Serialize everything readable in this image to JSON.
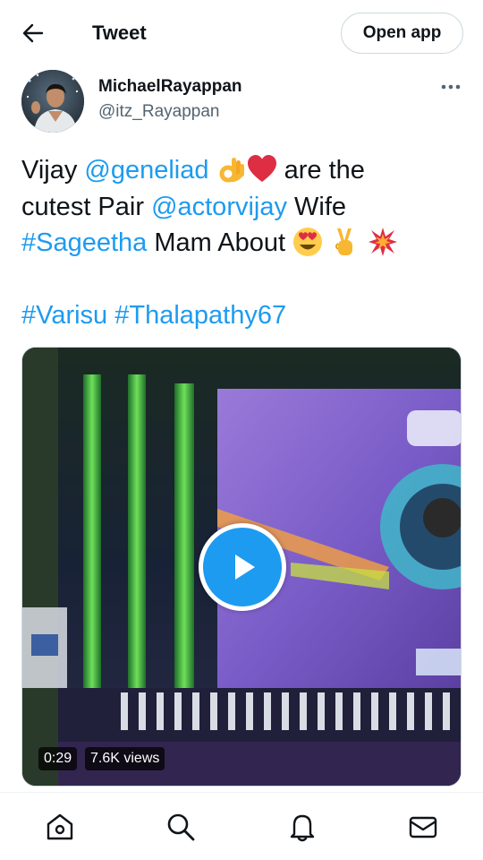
{
  "header": {
    "title": "Tweet",
    "open_app_label": "Open app"
  },
  "author": {
    "display_name": "MichaelRayappan",
    "handle": "@itz_Rayappan"
  },
  "tweet": {
    "line1_a": "Vijay ",
    "line1_mention": "@geneliad",
    "line1_b": " are the",
    "line2_a": "cutest Pair ",
    "line2_mention": "@actorvijay",
    "line2_b": " Wife",
    "line3_hashtag": "#Sageetha",
    "line3_b": " Mam About ",
    "line5_hashtag1": "#Varisu",
    "line5_hashtag2": "#Thalapathy67",
    "emojis": [
      "ok-hand-emoji",
      "red-heart-emoji",
      "heart-eyes-emoji",
      "victory-hand-emoji",
      "collision-emoji"
    ]
  },
  "video": {
    "duration": "0:29",
    "views": "7.6K views"
  },
  "nav": {
    "items": [
      "home-icon",
      "search-icon",
      "notifications-icon",
      "messages-icon"
    ]
  },
  "colors": {
    "accent": "#1d9bf0",
    "text": "#0f1419",
    "secondary": "#536471",
    "border": "#cfd9de"
  }
}
